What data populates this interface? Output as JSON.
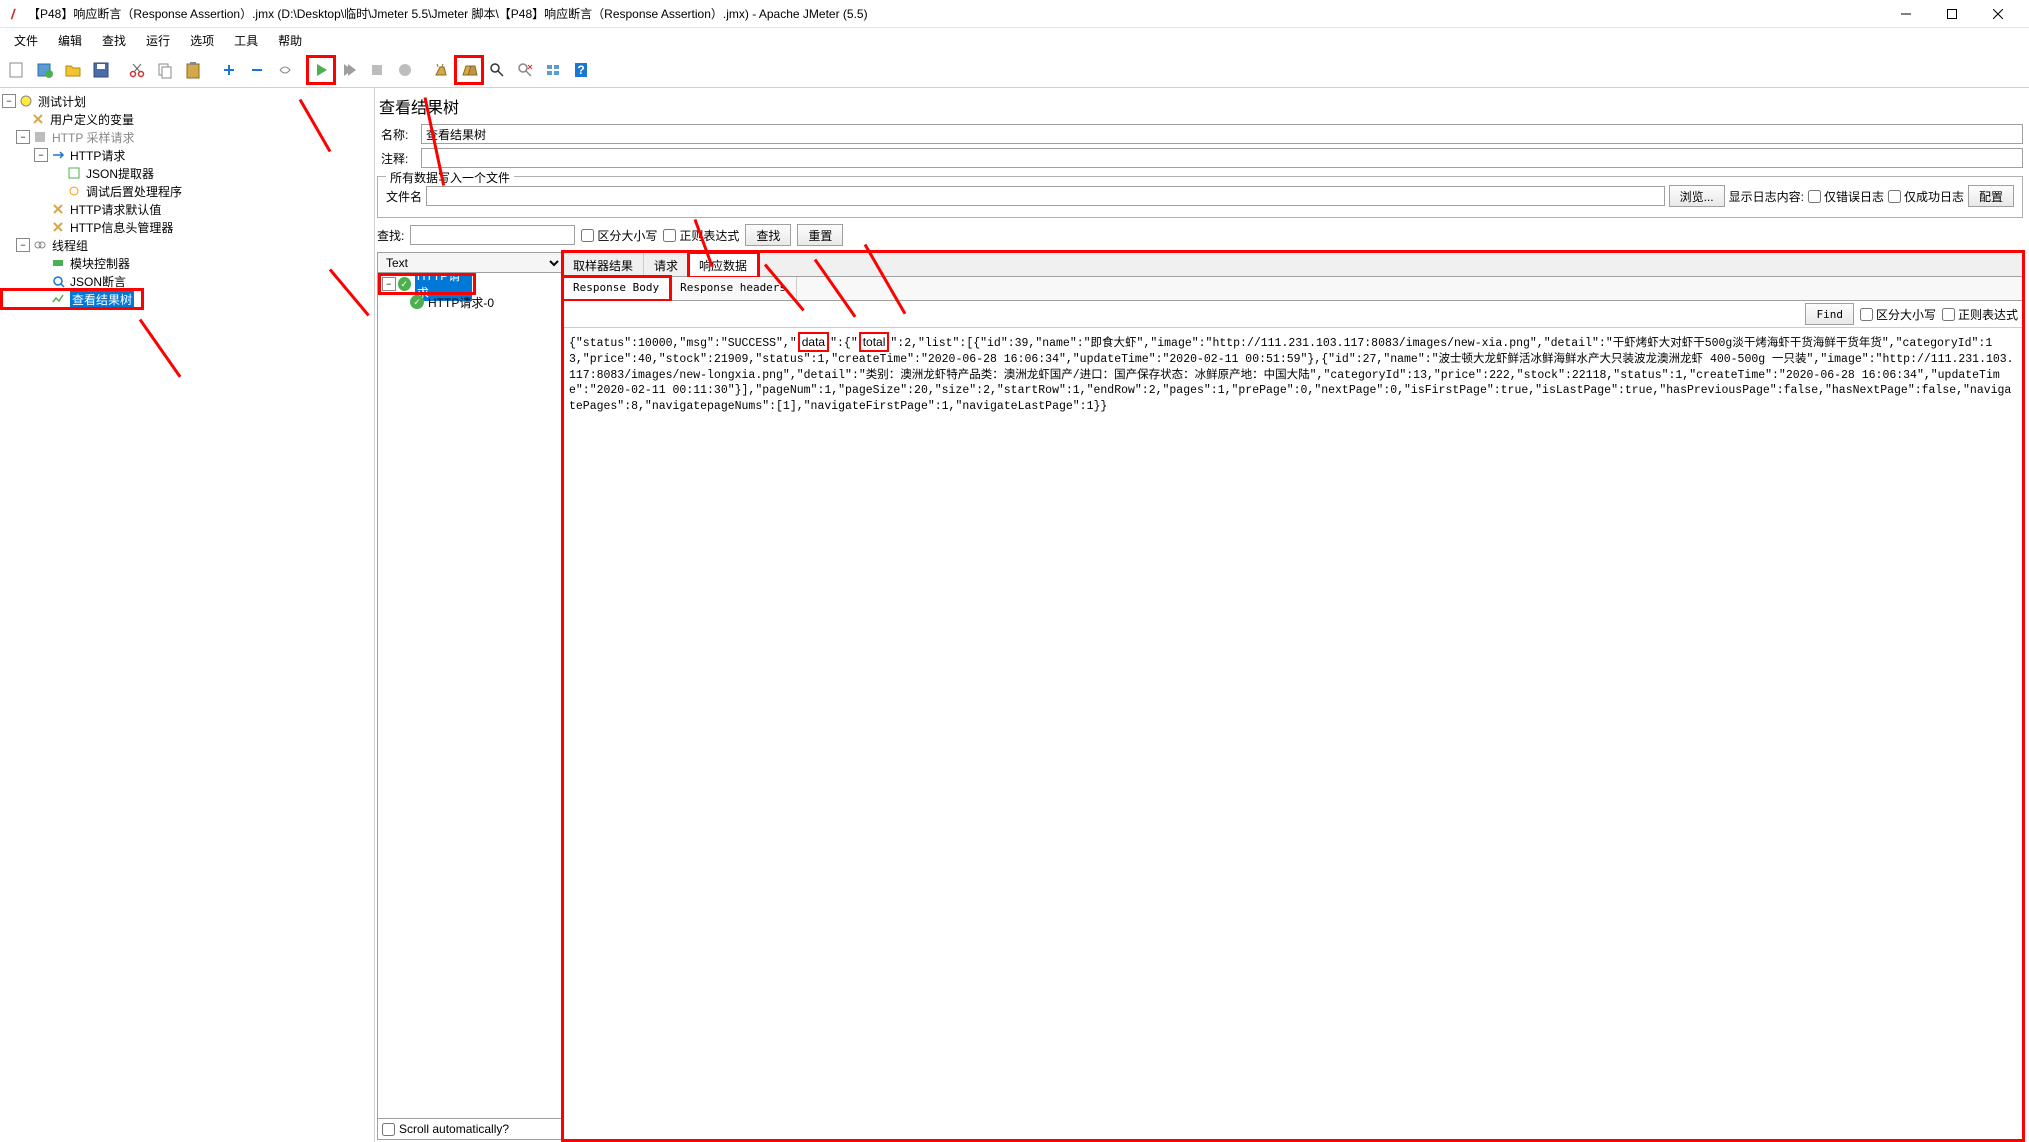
{
  "window": {
    "title": "【P48】响应断言（Response Assertion）.jmx (D:\\Desktop\\临时\\Jmeter 5.5\\Jmeter 脚本\\【P48】响应断言（Response Assertion）.jmx) - Apache JMeter (5.5)"
  },
  "menus": [
    "文件",
    "编辑",
    "查找",
    "运行",
    "选项",
    "工具",
    "帮助"
  ],
  "tree": {
    "root": "测试计划",
    "nodes": [
      {
        "label": "用户定义的变量",
        "depth": 1
      },
      {
        "label": "HTTP 采样请求",
        "depth": 1,
        "muted": true
      },
      {
        "label": "HTTP请求",
        "depth": 2
      },
      {
        "label": "JSON提取器",
        "depth": 3
      },
      {
        "label": "调试后置处理程序",
        "depth": 3
      },
      {
        "label": "HTTP请求默认值",
        "depth": 2
      },
      {
        "label": "HTTP信息头管理器",
        "depth": 2
      },
      {
        "label": "线程组",
        "depth": 1
      },
      {
        "label": "模块控制器",
        "depth": 2
      },
      {
        "label": "JSON断言",
        "depth": 2
      },
      {
        "label": "查看结果树",
        "depth": 2,
        "selected": true
      }
    ]
  },
  "panel": {
    "title": "查看结果树",
    "name_label": "名称:",
    "name_value": "查看结果树",
    "comment_label": "注释:",
    "comment_value": "",
    "file_group_legend": "所有数据写入一个文件",
    "filename_label": "文件名",
    "filename_value": "",
    "browse_btn": "浏览...",
    "show_log_label": "显示日志内容:",
    "only_error_label": "仅错误日志",
    "only_success_label": "仅成功日志",
    "config_btn": "配置"
  },
  "search": {
    "label": "查找:",
    "value": "",
    "case_sensitive": "区分大小写",
    "regex": "正则表达式",
    "find_btn": "查找",
    "reset_btn": "重置"
  },
  "results": {
    "renderer": "Text",
    "rows": [
      {
        "label": "HTTP请求",
        "selected": true,
        "depth": 0
      },
      {
        "label": "HTTP请求-0",
        "depth": 1
      }
    ],
    "scroll_auto": "Scroll automatically?"
  },
  "tabs": {
    "main": [
      "取样器结果",
      "请求",
      "响应数据"
    ],
    "active_main": 2,
    "sub": [
      "Response Body",
      "Response headers"
    ],
    "active_sub": 0
  },
  "find_bar": {
    "find_btn": "Find",
    "case": "区分大小写",
    "regex": "正则表达式"
  },
  "response_text_parts": {
    "p1": "{\"status\":10000,\"msg\":\"SUCCESS\",\"",
    "p2_data": "data",
    "p3": "\":{\"",
    "p4_total": "total",
    "p5": "\":2,\"list\":[{\"id\":39,\"name\":\"即食大虾\",\"image\":\"http://111.231.103.117:8083/images/new-xia.png\",\"detail\":\"干虾烤虾大对虾干500g淡干烤海虾干货海鲜干货年货\",\"categoryId\":13,\"price\":40,\"stock\":21909,\"status\":1,\"createTime\":\"2020-06-28 16:06:34\",\"updateTime\":\"2020-02-11 00:51:59\"},{\"id\":27,\"name\":\"波士顿大龙虾鲜活冰鲜海鲜水产大只装波龙澳洲龙虾 400-500g 一只装\",\"image\":\"http://111.231.103.117:8083/images/new-longxia.png\",\"detail\":\"类别：澳洲龙虾特产品类：澳洲龙虾国产/进口：国产保存状态：冰鲜原产地：中国大陆\",\"categoryId\":13,\"price\":222,\"stock\":22118,\"status\":1,\"createTime\":\"2020-06-28 16:06:34\",\"updateTime\":\"2020-02-11 00:11:30\"}],\"pageNum\":1,\"pageSize\":20,\"size\":2,\"startRow\":1,\"endRow\":2,\"pages\":1,\"prePage\":0,\"nextPage\":0,\"isFirstPage\":true,\"isLastPage\":true,\"hasPreviousPage\":false,\"hasNextPage\":false,\"navigatePages\":8,\"navigatepageNums\":[1],\"navigateFirstPage\":1,\"navigateLastPage\":1}}"
  }
}
